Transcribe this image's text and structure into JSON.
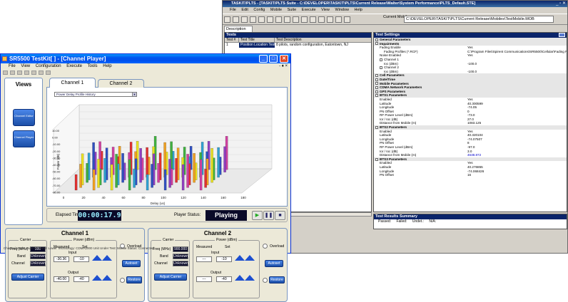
{
  "back_window": {
    "title": "TASKIT/PLTS - [TASKIT/PLTS Suite - C:\\DEVELOPER\\TASKIT\\PLTS\\Current Release\\Walter\\System Performance\\PLTS_Default.STE]",
    "menu": [
      "File",
      "Edit",
      "Config",
      "Mobile",
      "Suite",
      "Execute",
      "View",
      "Window",
      "Help"
    ],
    "current_mobile_label": "Current Mobile:",
    "mobile_path": "C:\\DEVELOPER\\TASKIT\\PLTS\\Current Release\\Mobiles\\TestMobile.MOB",
    "description_tab": "Description",
    "tests": {
      "header": "Tests",
      "columns": [
        "Test #",
        "Test Title",
        "Test Description"
      ],
      "rows": [
        {
          "num": "1",
          "title": "Position Location Test",
          "desc": "8 pilots, random configuration, Eatontown, NJ"
        }
      ]
    },
    "settings": {
      "header": "Test Settings",
      "rows": [
        {
          "key": "General Parameters",
          "value": "",
          "level": 0,
          "section": true
        },
        {
          "key": "Impairments",
          "value": "",
          "level": 0,
          "section": true
        },
        {
          "key": "Fading Enable",
          "value": "Yes",
          "level": 1,
          "section": false
        },
        {
          "key": "Fading Profiles (*.RCF)",
          "value": "C:\\Program Files\\Spirent Communications\\SR5500\\Cellular\\Fading Profiles\\AWGN.rcf",
          "level": 2,
          "section": false
        },
        {
          "key": "Noise Enabled",
          "value": "Yes",
          "level": 1,
          "section": false
        },
        {
          "key": "Channel 1",
          "value": "",
          "level": 1,
          "section": false,
          "box": true
        },
        {
          "key": "Ioc (dBm)",
          "value": "-100.0",
          "level": 2,
          "section": false
        },
        {
          "key": "Channel 2",
          "value": "",
          "level": 1,
          "section": false,
          "box": true
        },
        {
          "key": "Ioc (dBm)",
          "value": "-100.0",
          "level": 2,
          "section": false
        },
        {
          "key": "Cell Parameters",
          "value": "",
          "level": 0,
          "section": true
        },
        {
          "key": "Date/Time",
          "value": "",
          "level": 0,
          "section": true
        },
        {
          "key": "Mobile Parameters",
          "value": "",
          "level": 0,
          "section": true
        },
        {
          "key": "CDMA Network Parameters",
          "value": "",
          "level": 0,
          "section": true
        },
        {
          "key": "GPS Parameters",
          "value": "",
          "level": 0,
          "section": true
        },
        {
          "key": "BTS1 Parameters",
          "value": "",
          "level": 0,
          "section": true
        },
        {
          "key": "Enabled",
          "value": "Yes",
          "level": 1,
          "section": false
        },
        {
          "key": "Latitude",
          "value": "40.300599",
          "level": 1,
          "section": false
        },
        {
          "key": "Longitude",
          "value": "-74.05",
          "level": 1,
          "section": false
        },
        {
          "key": "PN Offset",
          "value": "0",
          "level": 1,
          "section": false
        },
        {
          "key": "RF Power Level (dBm)",
          "value": "-73.0",
          "level": 1,
          "section": false
        },
        {
          "key": "Ior / Ioc (dB)",
          "value": "27.0",
          "level": 1,
          "section": false
        },
        {
          "key": "Distance from Mobile (m)",
          "value": "1083.125",
          "level": 1,
          "section": false
        },
        {
          "key": "BTS2 Parameters",
          "value": "",
          "level": 0,
          "section": true
        },
        {
          "key": "Enabled",
          "value": "Yes",
          "level": 1,
          "section": false
        },
        {
          "key": "Latitude",
          "value": "40.320104",
          "level": 1,
          "section": false
        },
        {
          "key": "Longitude",
          "value": "-74.07507",
          "level": 1,
          "section": false
        },
        {
          "key": "PN Offset",
          "value": "8",
          "level": 1,
          "section": false
        },
        {
          "key": "RF Power Level (dBm)",
          "value": "-97.0",
          "level": 1,
          "section": false
        },
        {
          "key": "Ior / Ioc (dB)",
          "value": "3.0",
          "level": 1,
          "section": false
        },
        {
          "key": "Distance from Mobile (m)",
          "value": "4638.872",
          "level": 1,
          "section": false,
          "link": true
        },
        {
          "key": "BTS3 Parameters",
          "value": "",
          "level": 0,
          "section": true
        },
        {
          "key": "Enabled",
          "value": "Yes",
          "level": 1,
          "section": false
        },
        {
          "key": "Latitude",
          "value": "40.276855",
          "level": 1,
          "section": false
        },
        {
          "key": "Longitude",
          "value": "-74.068426",
          "level": 1,
          "section": false
        },
        {
          "key": "PN Offset",
          "value": "16",
          "level": 1,
          "section": false
        }
      ]
    },
    "results": {
      "header": "Test Results Summary",
      "columns": [
        "Passed:",
        "Failed:",
        "Undet.:",
        "N/A:"
      ]
    }
  },
  "front_window": {
    "title": "SR5500 TestKit[  ] - [Channel Player]",
    "menu": [
      "File",
      "View",
      "Configuration",
      "Execute",
      "Tools",
      "Help"
    ],
    "views": {
      "title": "Views",
      "buttons": [
        "Channel Editor",
        "Channel Player"
      ]
    },
    "tabs": [
      "Channel 1",
      "Channel 2"
    ],
    "dropdown": "Power Delay Profile History",
    "chart": {
      "ylabel": "Power (dB)",
      "xlabel": "Delay (us)",
      "xticks": [
        "0",
        "20",
        "40",
        "60",
        "80",
        "100",
        "120",
        "140",
        "160",
        "180"
      ],
      "yticks": [
        "10.00",
        "0.00",
        "-10.00",
        "-20.00",
        "-30.00",
        "-40.00",
        "-50.00",
        "-60.00",
        "-70.00",
        "-80.00"
      ]
    },
    "elapsed_label": "Elapsed Time:",
    "elapsed_value": "00:00:17.9",
    "player_status_label": "Player Status:",
    "player_status_value": "Playing",
    "channel1": {
      "title": "Channel 1",
      "carrier_label": "Carrier",
      "power_label": "Power (dBm)",
      "freq_label": "Freq (MHz)",
      "freq": "900",
      "band_label": "Band",
      "band": "Unknown",
      "channel_label": "Channel",
      "channel": "Unknown",
      "adjust": "Adjust Carrier",
      "measured": "Measured",
      "set": "Set",
      "input_label": "Input",
      "input_measured": "-30.36",
      "input_set": "-10",
      "output_label": "Output",
      "output_measured": "-40.00",
      "output_set": "-40",
      "overload": "Overload",
      "autoset": "Autoset",
      "restore": "Restore"
    },
    "channel2": {
      "title": "Channel 2",
      "carrier_label": "Carrier",
      "power_label": "Power (dBm)",
      "freq_label": "Freq (MHz)",
      "freq": "900.000",
      "band_label": "Band",
      "band": "Unknown",
      "channel_label": "Channel",
      "channel": "Unknown",
      "adjust": "Adjust Carrier",
      "measured": "Measured",
      "set": "Set",
      "input_label": "Input",
      "input_measured": "---",
      "input_set": "-10",
      "output_label": "Output",
      "output_measured": "---",
      "output_set": "-40",
      "overload": "Overload",
      "autoset": "Autoset",
      "restore": "Restore"
    },
    "statusbar": "Channel Mode: Dual   RF Band: Lower   Technology: CDMA2000   Unit Under Test: Mobile   Status: Connected"
  }
}
